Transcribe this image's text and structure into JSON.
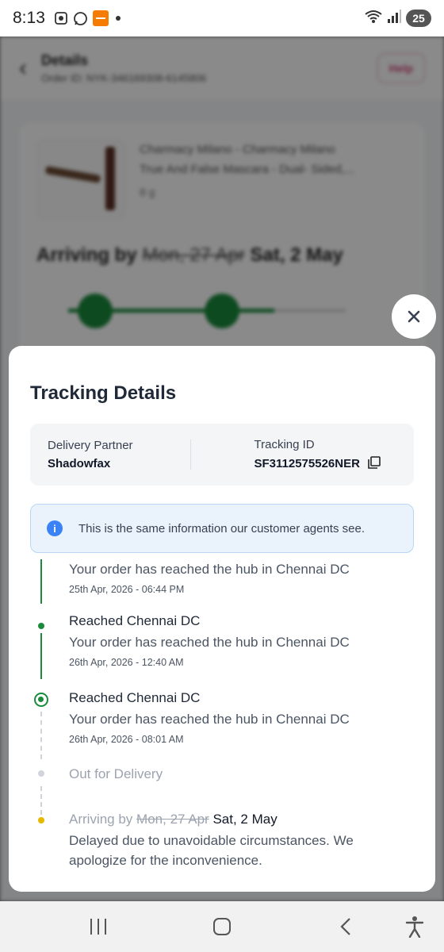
{
  "status_bar": {
    "time": "8:13",
    "battery": "25"
  },
  "background": {
    "header_title": "Details",
    "order_id": "Order ID: NYK-346169308-6145806",
    "help_label": "Help",
    "product_name_line1": "Charmacy Milano - Charmacy Milano",
    "product_name_line2": "True And False Mascara - Dual- Sided,...",
    "product_variant": "8 g",
    "arriving_prefix": "Arriving by",
    "arriving_old": "Mon, 27 Apr",
    "arriving_new": "Sat, 2 May"
  },
  "sheet": {
    "title": "Tracking Details",
    "partner_label": "Delivery Partner",
    "partner_value": "Shadowfax",
    "tracking_label": "Tracking ID",
    "tracking_value": "SF3112575526NER",
    "info_text": "This is the same information our customer agents see."
  },
  "timeline": {
    "items": [
      {
        "title": "",
        "desc": "Your order has reached the hub in Chennai DC",
        "date": "25th Apr, 2026 - 06:44 PM"
      },
      {
        "title": "Reached Chennai DC",
        "desc": "Your order has reached the hub in Chennai DC",
        "date": "26th Apr, 2026 - 12:40 AM"
      },
      {
        "title": "Reached Chennai DC",
        "desc": "Your order has reached the hub in Chennai DC",
        "date": "26th Apr, 2026 - 08:01 AM"
      },
      {
        "title": "Out for Delivery"
      },
      {
        "title_prefix": "Arriving by",
        "title_old": "Mon, 27 Apr",
        "title_new": "Sat, 2 May",
        "desc": "Delayed due to unavoidable circumstances. We apologize for the inconvenience."
      }
    ]
  },
  "colors": {
    "accent_green": "#1a8a3c",
    "info_blue": "#3b82f6",
    "pending_yellow": "#e6b800"
  },
  "icons": [
    "close-icon",
    "copy-icon",
    "info-icon",
    "recents-icon",
    "home-icon",
    "back-icon",
    "accessibility-icon"
  ]
}
